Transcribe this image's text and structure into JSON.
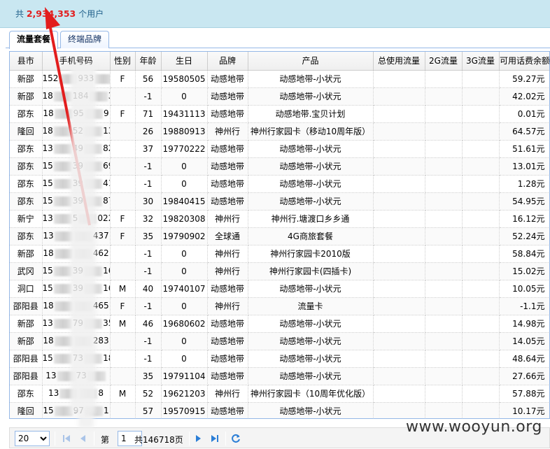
{
  "summary": {
    "prefix": "共",
    "count": "2,934,353",
    "suffix": "个用户"
  },
  "tabs": [
    {
      "label": "流量套餐",
      "active": true
    },
    {
      "label": "终端品牌",
      "active": false
    }
  ],
  "columns": [
    "县市",
    "手机号码",
    "性别",
    "年龄",
    "生日",
    "品牌",
    "产品",
    "总使用流量",
    "2G流量",
    "3G流量",
    "可用话费余额"
  ],
  "rows": [
    {
      "city": "新邵",
      "phone_a": "152",
      "phone_b": "933",
      "phone_c": "9",
      "gender": "F",
      "age": "56",
      "birthday": "19580505",
      "brand": "动感地带",
      "product": "动感地带-小状元",
      "balance": "59.27元"
    },
    {
      "city": "新邵",
      "phone_a": "18",
      "phone_b": "184",
      "phone_c": "3",
      "gender": "",
      "age": "-1",
      "birthday": "0",
      "brand": "动感地带",
      "product": "动感地带-小状元",
      "balance": "42.02元"
    },
    {
      "city": "邵东",
      "phone_a": "18",
      "phone_b": "95",
      "phone_c": "9",
      "gender": "F",
      "age": "71",
      "birthday": "19431113",
      "brand": "动感地带",
      "product": "动感地带.宝贝计划",
      "balance": "0.01元"
    },
    {
      "city": "隆回",
      "phone_a": "18",
      "phone_b": "52",
      "phone_c": "13",
      "gender": "",
      "age": "26",
      "birthday": "19880913",
      "brand": "神州行",
      "product": "神州行家园卡（移动10周年版）",
      "balance": "64.57元"
    },
    {
      "city": "邵东",
      "phone_a": "13",
      "phone_b": "49",
      "phone_c": "82",
      "gender": "",
      "age": "37",
      "birthday": "19770222",
      "brand": "动感地带",
      "product": "动感地带-小状元",
      "balance": "51.61元"
    },
    {
      "city": "邵东",
      "phone_a": "15",
      "phone_b": "39",
      "phone_c": "69",
      "gender": "",
      "age": "-1",
      "birthday": "0",
      "brand": "动感地带",
      "product": "动感地带-小状元",
      "balance": "13.01元"
    },
    {
      "city": "邵东",
      "phone_a": "15",
      "phone_b": "39",
      "phone_c": "41",
      "gender": "",
      "age": "-1",
      "birthday": "0",
      "brand": "动感地带",
      "product": "动感地带-小状元",
      "balance": "1.28元"
    },
    {
      "city": "邵东",
      "phone_a": "15",
      "phone_b": "39",
      "phone_c": "879",
      "gender": "",
      "age": "30",
      "birthday": "19840415",
      "brand": "动感地带",
      "product": "动感地带-小状元",
      "balance": "54.95元"
    },
    {
      "city": "新宁",
      "phone_a": "13",
      "phone_b": "5",
      "phone_c": "022",
      "gender": "F",
      "age": "32",
      "birthday": "19820308",
      "brand": "神州行",
      "product": "神州行.塘渡口乡乡通",
      "balance": "16.12元"
    },
    {
      "city": "邵东",
      "phone_a": "13",
      "phone_b": "",
      "phone_c": "437",
      "gender": "F",
      "age": "35",
      "birthday": "19790902",
      "brand": "全球通",
      "product": "4G商旅套餐",
      "balance": "52.24元"
    },
    {
      "city": "新邵",
      "phone_a": "18",
      "phone_b": "",
      "phone_c": "462",
      "gender": "",
      "age": "-1",
      "birthday": "0",
      "brand": "神州行",
      "product": "神州行家园卡2010版",
      "balance": "58.84元"
    },
    {
      "city": "武冈",
      "phone_a": "15",
      "phone_b": "39",
      "phone_c": "164",
      "gender": "",
      "age": "-1",
      "birthday": "0",
      "brand": "神州行",
      "product": "神州行家园卡(四插卡)",
      "balance": "15.02元"
    },
    {
      "city": "洞口",
      "phone_a": "15",
      "phone_b": "39",
      "phone_c": "168",
      "gender": "M",
      "age": "40",
      "birthday": "19740107",
      "brand": "动感地带",
      "product": "动感地带-小状元",
      "balance": "10.05元"
    },
    {
      "city": "邵阳县",
      "phone_a": "18",
      "phone_b": "",
      "phone_c": "465",
      "gender": "F",
      "age": "-1",
      "birthday": "0",
      "brand": "神州行",
      "product": "流量卡",
      "balance": "-1.1元"
    },
    {
      "city": "新邵",
      "phone_a": "13",
      "phone_b": "79",
      "phone_c": "359",
      "gender": "M",
      "age": "46",
      "birthday": "19680602",
      "brand": "动感地带",
      "product": "动感地带-小状元",
      "balance": "14.98元"
    },
    {
      "city": "新邵",
      "phone_a": "18",
      "phone_b": "",
      "phone_c": "283",
      "gender": "",
      "age": "-1",
      "birthday": "0",
      "brand": "动感地带",
      "product": "动感地带-小状元",
      "balance": "14.05元"
    },
    {
      "city": "邵阳县",
      "phone_a": "15",
      "phone_b": "73",
      "phone_c": "18",
      "gender": "",
      "age": "-1",
      "birthday": "0",
      "brand": "动感地带",
      "product": "动感地带-小状元",
      "balance": "48.64元"
    },
    {
      "city": "邵阳县",
      "phone_a": "13",
      "phone_b": "73",
      "phone_c": "",
      "gender": "",
      "age": "35",
      "birthday": "19791104",
      "brand": "动感地带",
      "product": "动感地带-小状元",
      "balance": "27.66元"
    },
    {
      "city": "邵东",
      "phone_a": "13",
      "phone_b": "",
      "phone_c": "8",
      "gender": "M",
      "age": "52",
      "birthday": "19621203",
      "brand": "神州行",
      "product": "神州行家园卡（10周年优化版）",
      "balance": "57.88元"
    },
    {
      "city": "隆回",
      "phone_a": "15",
      "phone_b": "97",
      "phone_c": "1",
      "gender": "",
      "age": "57",
      "birthday": "19570915",
      "brand": "动感地带",
      "product": "动感地带-小状元",
      "balance": "10.17元"
    }
  ],
  "pager": {
    "page_size": "20",
    "page_label": "第",
    "page_value": "1",
    "total_pages_label": "共146718页",
    "icons": [
      "first-page-icon",
      "prev-page-icon",
      "next-page-icon",
      "last-page-icon",
      "refresh-icon"
    ]
  },
  "watermark": "www.wooyun.org",
  "colors": {
    "accent": "#e21d1d",
    "header_bg": "#c9e7f1",
    "border": "#95b8e7"
  }
}
